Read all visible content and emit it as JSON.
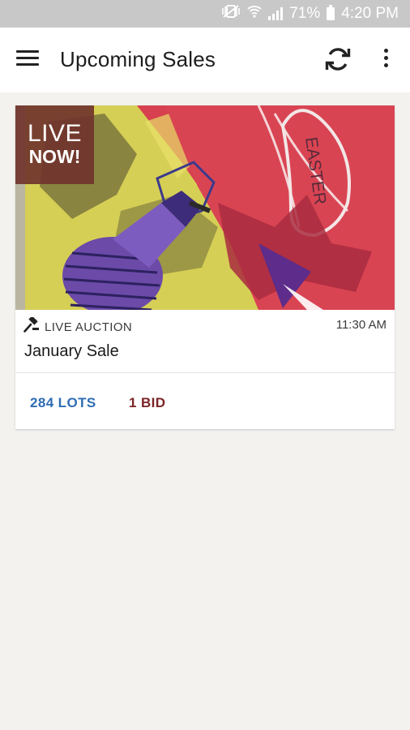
{
  "status_bar": {
    "battery_percent": "71%",
    "time": "4:20 PM",
    "icons": [
      "mute-vibrate-icon",
      "wifi-icon",
      "signal-icon",
      "battery-icon"
    ],
    "background": "#c8c8c8"
  },
  "app_bar": {
    "title": "Upcoming Sales",
    "icons": [
      "menu-icon",
      "refresh-icon",
      "more-vert-icon"
    ]
  },
  "sales": [
    {
      "badge_line1": "LIVE",
      "badge_line2": "NOW!",
      "artwork_text": "EASTER",
      "type_icon": "gavel-icon",
      "type_label": "LIVE AUCTION",
      "time": "11:30 AM",
      "name": "January Sale",
      "lots_label": "284 LOTS",
      "bids_label": "1 BID"
    }
  ],
  "colors": {
    "accent_blue": "#2f6db3",
    "accent_maroon": "#7b2426",
    "badge_bg": "#70342c",
    "page_bg": "#f3f2ef"
  }
}
